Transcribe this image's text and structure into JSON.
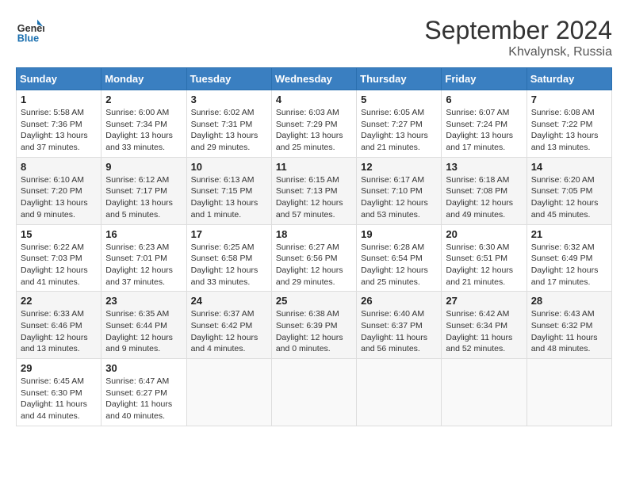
{
  "logo": {
    "text_general": "General",
    "text_blue": "Blue"
  },
  "title": "September 2024",
  "subtitle": "Khvalynsk, Russia",
  "days_of_week": [
    "Sunday",
    "Monday",
    "Tuesday",
    "Wednesday",
    "Thursday",
    "Friday",
    "Saturday"
  ],
  "weeks": [
    [
      {
        "day": "1",
        "sunrise": "5:58 AM",
        "sunset": "7:36 PM",
        "daylight": "13 hours and 37 minutes."
      },
      {
        "day": "2",
        "sunrise": "6:00 AM",
        "sunset": "7:34 PM",
        "daylight": "13 hours and 33 minutes."
      },
      {
        "day": "3",
        "sunrise": "6:02 AM",
        "sunset": "7:31 PM",
        "daylight": "13 hours and 29 minutes."
      },
      {
        "day": "4",
        "sunrise": "6:03 AM",
        "sunset": "7:29 PM",
        "daylight": "13 hours and 25 minutes."
      },
      {
        "day": "5",
        "sunrise": "6:05 AM",
        "sunset": "7:27 PM",
        "daylight": "13 hours and 21 minutes."
      },
      {
        "day": "6",
        "sunrise": "6:07 AM",
        "sunset": "7:24 PM",
        "daylight": "13 hours and 17 minutes."
      },
      {
        "day": "7",
        "sunrise": "6:08 AM",
        "sunset": "7:22 PM",
        "daylight": "13 hours and 13 minutes."
      }
    ],
    [
      {
        "day": "8",
        "sunrise": "6:10 AM",
        "sunset": "7:20 PM",
        "daylight": "13 hours and 9 minutes."
      },
      {
        "day": "9",
        "sunrise": "6:12 AM",
        "sunset": "7:17 PM",
        "daylight": "13 hours and 5 minutes."
      },
      {
        "day": "10",
        "sunrise": "6:13 AM",
        "sunset": "7:15 PM",
        "daylight": "13 hours and 1 minute."
      },
      {
        "day": "11",
        "sunrise": "6:15 AM",
        "sunset": "7:13 PM",
        "daylight": "12 hours and 57 minutes."
      },
      {
        "day": "12",
        "sunrise": "6:17 AM",
        "sunset": "7:10 PM",
        "daylight": "12 hours and 53 minutes."
      },
      {
        "day": "13",
        "sunrise": "6:18 AM",
        "sunset": "7:08 PM",
        "daylight": "12 hours and 49 minutes."
      },
      {
        "day": "14",
        "sunrise": "6:20 AM",
        "sunset": "7:05 PM",
        "daylight": "12 hours and 45 minutes."
      }
    ],
    [
      {
        "day": "15",
        "sunrise": "6:22 AM",
        "sunset": "7:03 PM",
        "daylight": "12 hours and 41 minutes."
      },
      {
        "day": "16",
        "sunrise": "6:23 AM",
        "sunset": "7:01 PM",
        "daylight": "12 hours and 37 minutes."
      },
      {
        "day": "17",
        "sunrise": "6:25 AM",
        "sunset": "6:58 PM",
        "daylight": "12 hours and 33 minutes."
      },
      {
        "day": "18",
        "sunrise": "6:27 AM",
        "sunset": "6:56 PM",
        "daylight": "12 hours and 29 minutes."
      },
      {
        "day": "19",
        "sunrise": "6:28 AM",
        "sunset": "6:54 PM",
        "daylight": "12 hours and 25 minutes."
      },
      {
        "day": "20",
        "sunrise": "6:30 AM",
        "sunset": "6:51 PM",
        "daylight": "12 hours and 21 minutes."
      },
      {
        "day": "21",
        "sunrise": "6:32 AM",
        "sunset": "6:49 PM",
        "daylight": "12 hours and 17 minutes."
      }
    ],
    [
      {
        "day": "22",
        "sunrise": "6:33 AM",
        "sunset": "6:46 PM",
        "daylight": "12 hours and 13 minutes."
      },
      {
        "day": "23",
        "sunrise": "6:35 AM",
        "sunset": "6:44 PM",
        "daylight": "12 hours and 9 minutes."
      },
      {
        "day": "24",
        "sunrise": "6:37 AM",
        "sunset": "6:42 PM",
        "daylight": "12 hours and 4 minutes."
      },
      {
        "day": "25",
        "sunrise": "6:38 AM",
        "sunset": "6:39 PM",
        "daylight": "12 hours and 0 minutes."
      },
      {
        "day": "26",
        "sunrise": "6:40 AM",
        "sunset": "6:37 PM",
        "daylight": "11 hours and 56 minutes."
      },
      {
        "day": "27",
        "sunrise": "6:42 AM",
        "sunset": "6:34 PM",
        "daylight": "11 hours and 52 minutes."
      },
      {
        "day": "28",
        "sunrise": "6:43 AM",
        "sunset": "6:32 PM",
        "daylight": "11 hours and 48 minutes."
      }
    ],
    [
      {
        "day": "29",
        "sunrise": "6:45 AM",
        "sunset": "6:30 PM",
        "daylight": "11 hours and 44 minutes."
      },
      {
        "day": "30",
        "sunrise": "6:47 AM",
        "sunset": "6:27 PM",
        "daylight": "11 hours and 40 minutes."
      },
      null,
      null,
      null,
      null,
      null
    ]
  ]
}
